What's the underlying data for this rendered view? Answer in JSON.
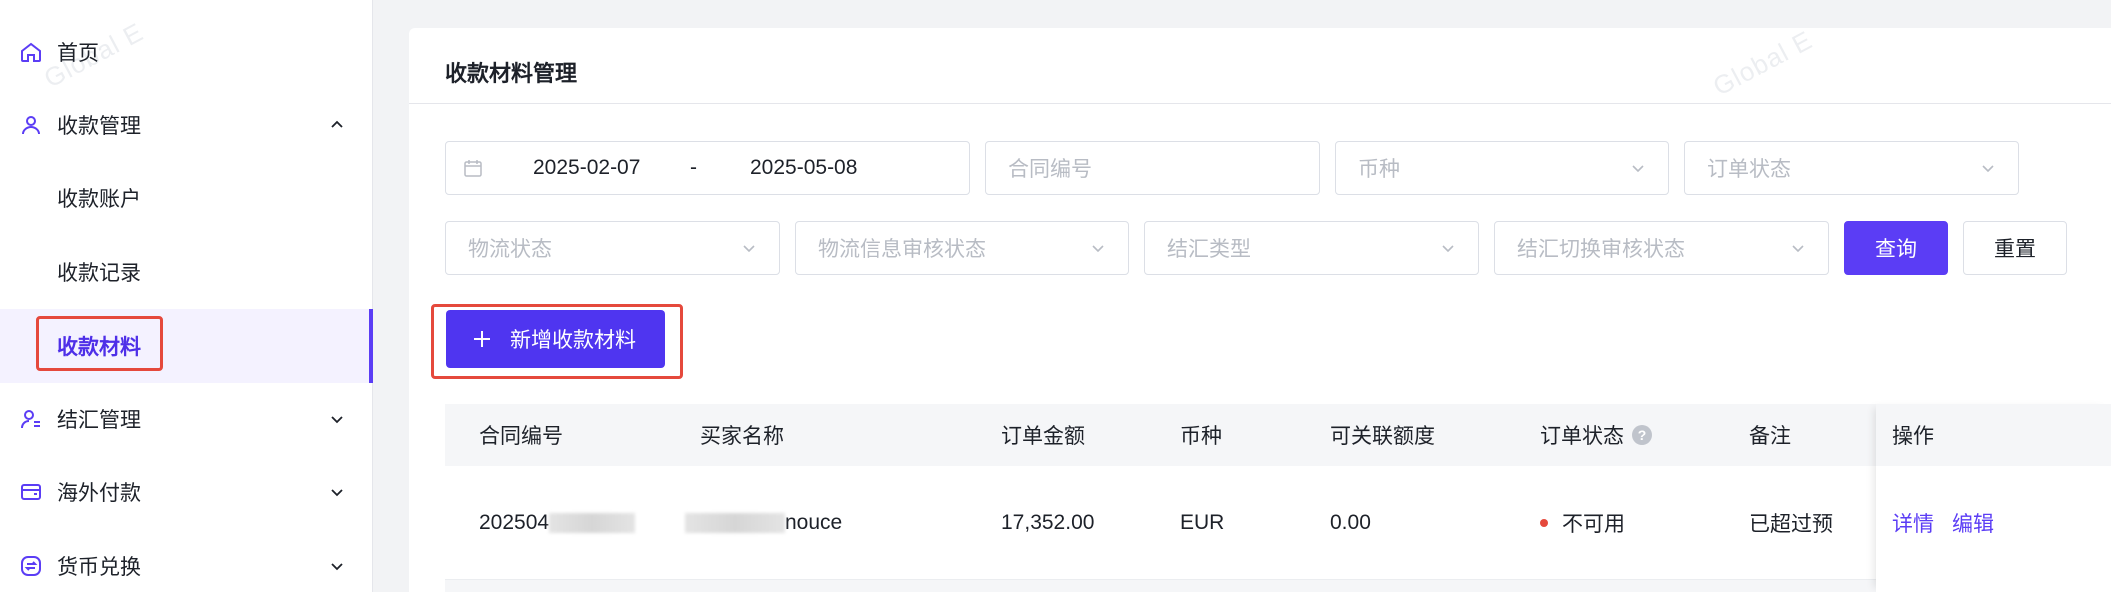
{
  "sidebar": {
    "items": [
      {
        "label": "首页",
        "icon": "home-icon"
      },
      {
        "label": "收款管理",
        "icon": "user-icon",
        "expanded": true
      },
      {
        "label": "收款账户"
      },
      {
        "label": "收款记录"
      },
      {
        "label": "收款材料",
        "active": true
      },
      {
        "label": "结汇管理",
        "icon": "user-list-icon"
      },
      {
        "label": "海外付款",
        "icon": "wallet-icon"
      },
      {
        "label": "货币兑换",
        "icon": "exchange-icon"
      }
    ]
  },
  "watermark": "Global E",
  "page": {
    "title": "收款材料管理"
  },
  "filters": {
    "date_start": "2025-02-07",
    "date_sep": "-",
    "date_end": "2025-05-08",
    "contract_no_placeholder": "合同编号",
    "currency_placeholder": "币种",
    "order_status_placeholder": "订单状态",
    "logistics_status_placeholder": "物流状态",
    "logistics_review_placeholder": "物流信息审核状态",
    "settlement_type_placeholder": "结汇类型",
    "settlement_switch_review_placeholder": "结汇切换审核状态",
    "query_label": "查询",
    "reset_label": "重置"
  },
  "actions": {
    "add_label": "新增收款材料"
  },
  "table": {
    "columns": [
      "合同编号",
      "买家名称",
      "订单金额",
      "币种",
      "可关联额度",
      "订单状态",
      "备注",
      "操作"
    ],
    "rows": [
      {
        "contract_no": "202504",
        "buyer": "nouce",
        "amount": "17,352.00",
        "currency": "EUR",
        "available": "0.00",
        "status": "不可用",
        "remark": "已超过预",
        "ops": [
          "详情",
          "编辑"
        ]
      }
    ]
  },
  "colors": {
    "primary": "#5b3df5",
    "highlight": "#e5493c",
    "status_dot": "#e5493c"
  }
}
